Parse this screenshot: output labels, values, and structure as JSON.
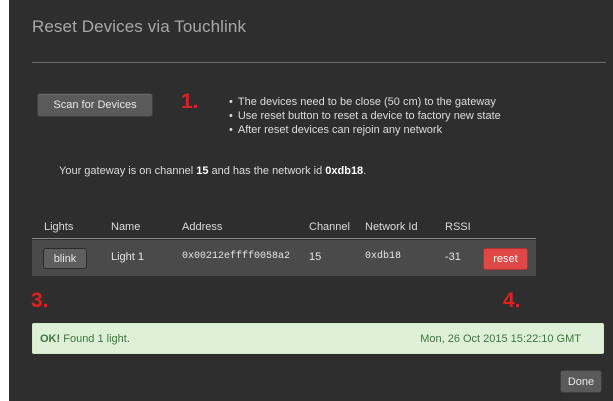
{
  "dialog": {
    "title": "Reset Devices via Touchlink"
  },
  "scan": {
    "button_label": "Scan for Devices"
  },
  "steps": {
    "one": "1.",
    "three": "3.",
    "four": "4."
  },
  "instructions": [
    "The devices need to be close (50 cm) to the gateway",
    "Use reset button to reset a device to factory new state",
    "After reset devices can rejoin any network"
  ],
  "gateway_info": {
    "prefix": "Your gateway is on channel",
    "channel": "15",
    "middle": "and has the network id",
    "network_id": "0xdb18",
    "suffix": "."
  },
  "table": {
    "headers": [
      "Lights",
      "Name",
      "Address",
      "Channel",
      "Network Id",
      "RSSI"
    ],
    "rows": [
      {
        "blink_label": "blink",
        "name": "Light 1",
        "address": "0x00212effff0058a2",
        "channel": "15",
        "network_id": "0xdb18",
        "rssi": "-31",
        "reset_label": "reset"
      }
    ]
  },
  "status": {
    "ok_label": "OK!",
    "message": "Found 1 light.",
    "timestamp": "Mon, 26 Oct 2015 15:22:10 GMT"
  },
  "footer": {
    "done_label": "Done"
  },
  "colors": {
    "dialog_bg": "#2e2e2e",
    "step_marker": "#e02020",
    "reset_button": "#e04848",
    "alert_bg": "#dff0d8",
    "alert_text": "#3c763d"
  }
}
